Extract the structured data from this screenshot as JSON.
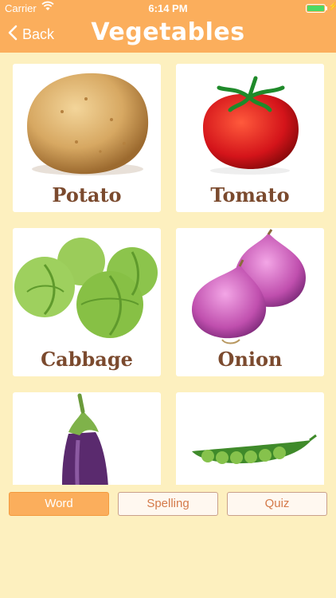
{
  "status": {
    "carrier": "Carrier",
    "time": "6:14 PM"
  },
  "nav": {
    "back_label": "Back",
    "title": "Vegetables"
  },
  "items": [
    {
      "name": "Potato",
      "icon": "potato-image"
    },
    {
      "name": "Tomato",
      "icon": "tomato-image"
    },
    {
      "name": "Cabbage",
      "icon": "cabbage-image"
    },
    {
      "name": "Onion",
      "icon": "onion-image"
    },
    {
      "name": "",
      "icon": "eggplant-image"
    },
    {
      "name": "",
      "icon": "peas-image"
    }
  ],
  "tabs": [
    {
      "label": "Word",
      "active": true
    },
    {
      "label": "Spelling",
      "active": false
    },
    {
      "label": "Quiz",
      "active": false
    }
  ],
  "colors": {
    "accent": "#fbae5c",
    "background": "#fdf0bf",
    "label": "#7b4a2e"
  }
}
